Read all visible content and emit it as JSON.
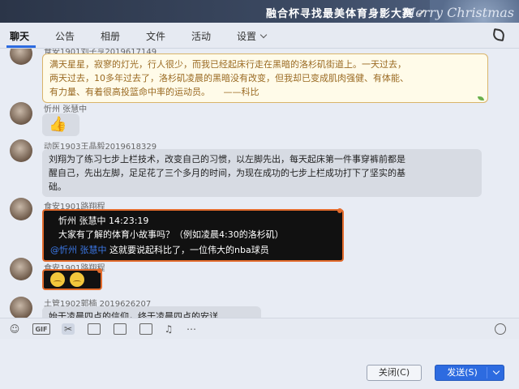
{
  "window": {
    "title": "融合杯寻找最美体育身影大赛",
    "decor_text": "Merry Christmas"
  },
  "tabs": [
    "聊天",
    "公告",
    "相册",
    "文件",
    "活动",
    "设置"
  ],
  "messages": [
    {
      "name": "食安1901刘子亨2019617149",
      "lines": [
        "满天星星，寂寥的灯光，行人很少，而我已经起床行走在黑暗的洛杉矶街道上。一天过去，",
        "两天过去，10多年过去了，洛杉矶凌晨的黑暗没有改变，但我却已变成肌肉强健、有体能、",
        "有力量、有着很高投篮命中率的运动员。　　——科比"
      ]
    },
    {
      "name": "忻州 张慧中",
      "content": "👍"
    },
    {
      "name": "动医1903王晶毅2019618329",
      "lines": [
        "刘翔为了练习七步上栏技术，改变自己的习惯，以左脚先出，每天起床第一件事穿裤前都是",
        "醒自己，先出左脚，足足花了三个多月的时间，为现在成功的七步上栏成功打下了坚实的基",
        "础。"
      ]
    },
    {
      "name": "食安1901路翔程",
      "quote_header": "忻州  张慧中     14:23:19",
      "quote_text": "大家有了解的体育小故事吗？（例如凌晨4:30的洛杉矶）",
      "mention": "@忻州 张慧中",
      "reply": "这就要说起科比了，一位伟大的nba球员"
    },
    {
      "name": "食安1901路翔程",
      "content": "emoji-faces"
    },
    {
      "name": "土管1902郭楠  2019626207",
      "lines": [
        "始于凌晨四点的信仰，终于凌晨四点的安详"
      ]
    }
  ],
  "buttons": {
    "close": "关闭(C)",
    "send": "发送(S)"
  }
}
